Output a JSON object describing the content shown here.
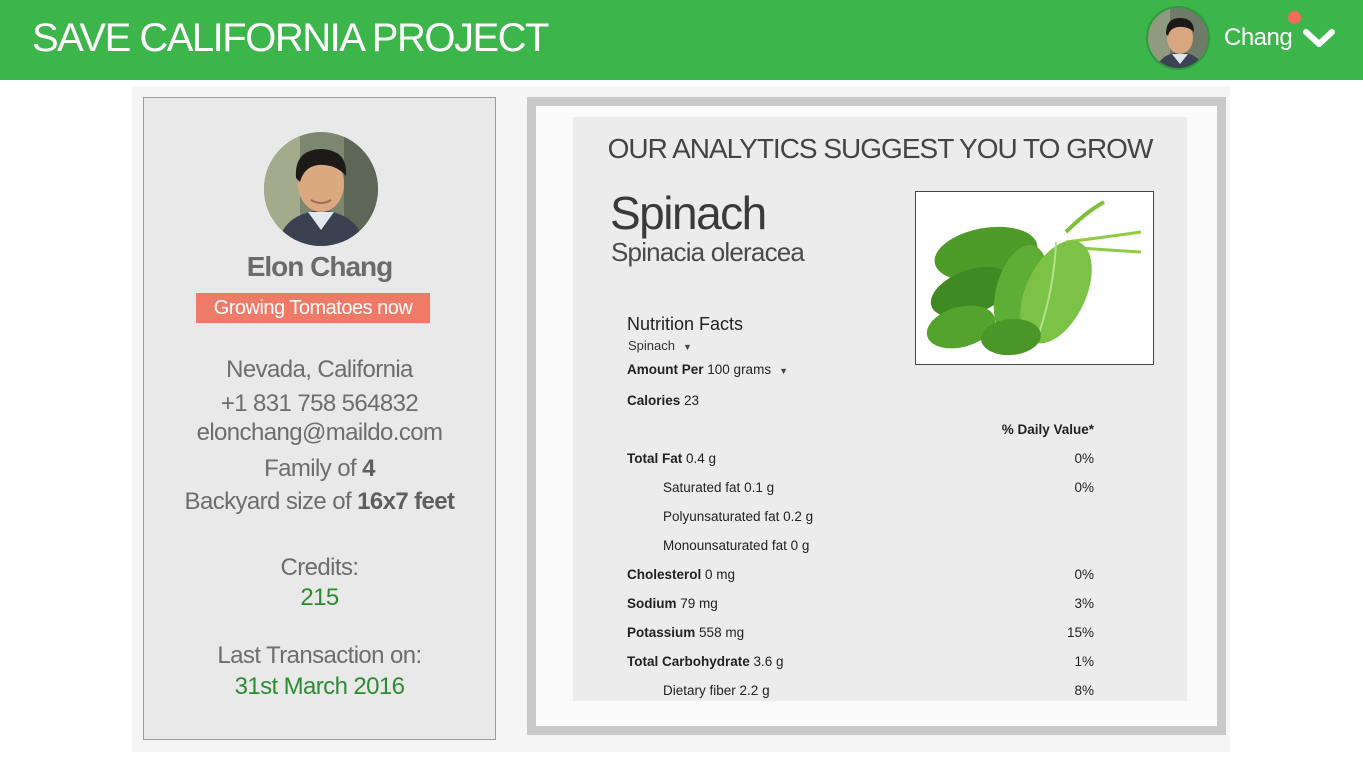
{
  "app": {
    "title": "SAVE CALIFORNIA PROJECT",
    "user_name": "Chang",
    "notification_color": "#f36b5b",
    "brand_color": "#3cb54a"
  },
  "profile": {
    "name": "Elon Chang",
    "status_badge": "Growing Tomatoes now",
    "location": "Nevada, California",
    "phone": "+1 831 758 564832",
    "email": "elonchang@maildo.com",
    "family_prefix": "Family of ",
    "family_size": "4",
    "backyard_prefix": "Backyard size of ",
    "backyard_size": "16x7 feet",
    "credits_label": "Credits:",
    "credits_value": "215",
    "last_txn_label": "Last Transaction on:",
    "last_txn_value": "31st March 2016"
  },
  "suggestion": {
    "heading": "OUR ANALYTICS SUGGEST YOU TO GROW",
    "plant_common": "Spinach",
    "plant_scientific": "Spinacia oleracea",
    "photo_icon": "spinach-leaves-photo"
  },
  "nutrition": {
    "title": "Nutrition Facts",
    "food": "Spinach",
    "amount_label": "Amount Per",
    "amount_value": "100 grams",
    "calories_label": "Calories",
    "calories_value": "23",
    "dv_header": "% Daily Value*",
    "rows": [
      {
        "label": "Total Fat",
        "value": "0.4 g",
        "dv": "0%"
      },
      {
        "label": "Saturated fat",
        "value": "0.1 g",
        "dv": "0%"
      },
      {
        "label": "Polyunsaturated fat",
        "value": "0.2 g",
        "dv": ""
      },
      {
        "label": "Monounsaturated fat",
        "value": "0 g",
        "dv": ""
      },
      {
        "label": "Cholesterol",
        "value": "0 mg",
        "dv": "0%"
      },
      {
        "label": "Sodium",
        "value": "79 mg",
        "dv": "3%"
      },
      {
        "label": "Potassium",
        "value": "558 mg",
        "dv": "15%"
      },
      {
        "label": "Total Carbohydrate",
        "value": "3.6 g",
        "dv": "1%"
      },
      {
        "label": "Dietary fiber",
        "value": "2.2 g",
        "dv": "8%"
      }
    ]
  }
}
